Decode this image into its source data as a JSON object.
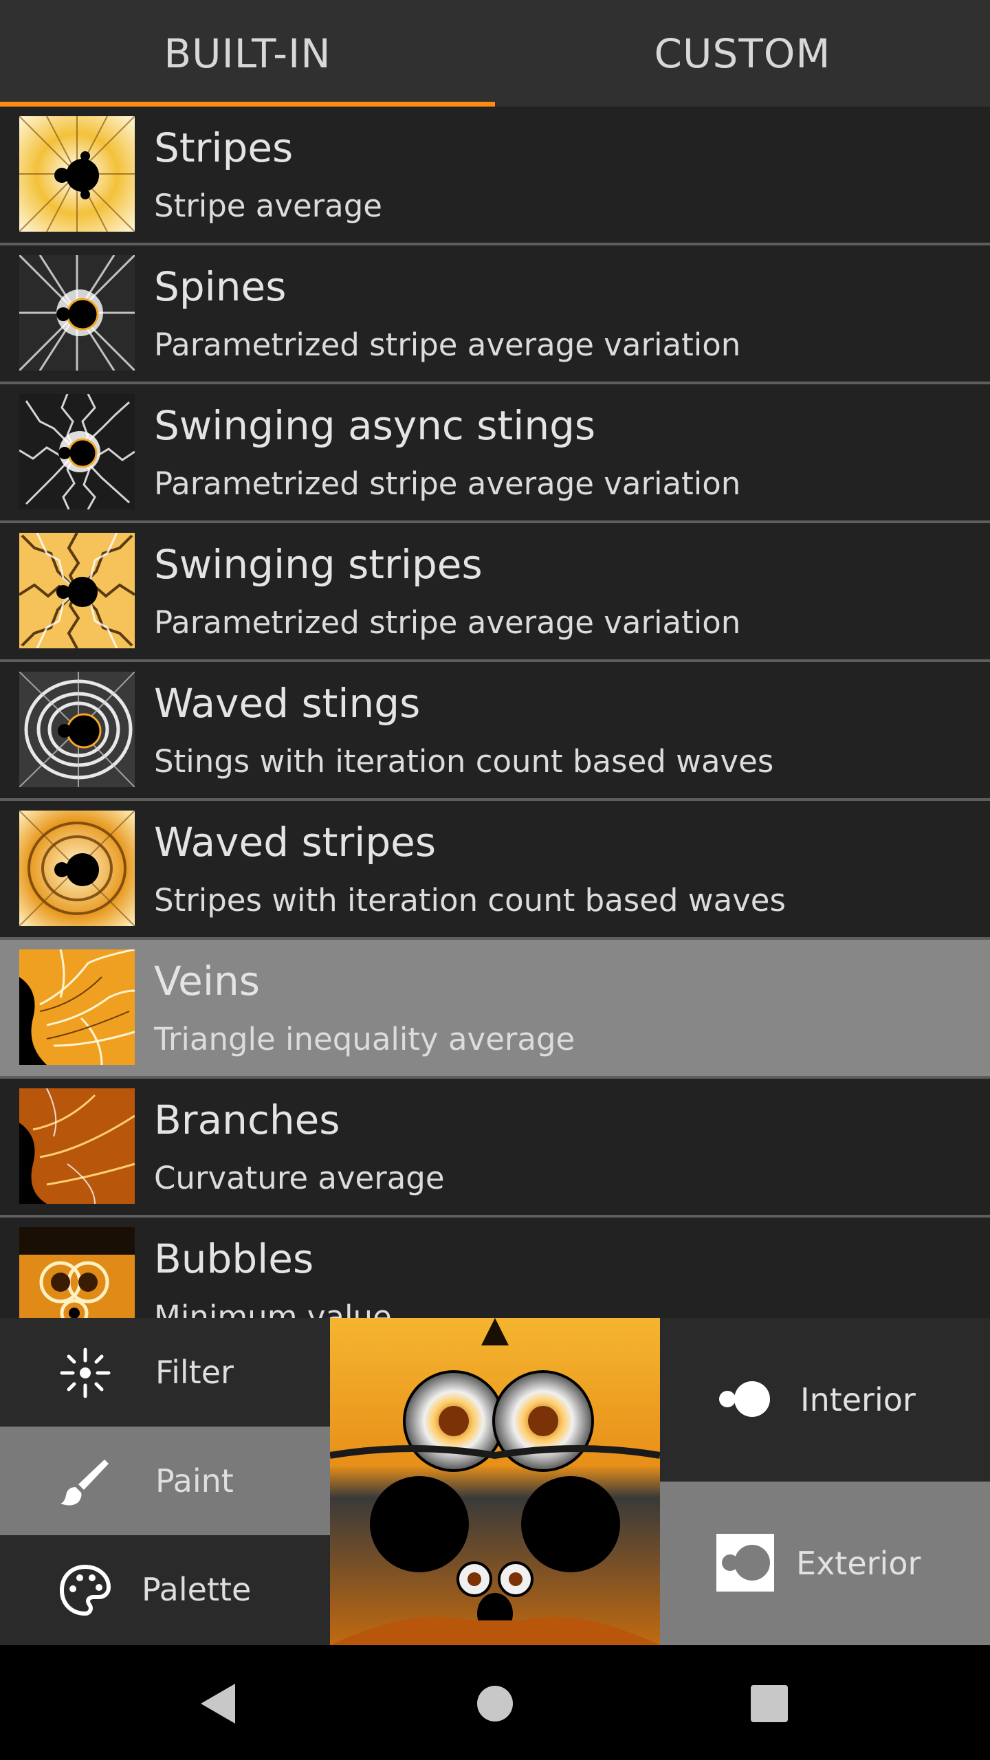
{
  "tabs": [
    {
      "label": "BUILT-IN",
      "active": true
    },
    {
      "label": "CUSTOM",
      "active": false
    }
  ],
  "accent_color": "#ff8c10",
  "list": [
    {
      "title": "Stripes",
      "subtitle": "Stripe average"
    },
    {
      "title": "Spines",
      "subtitle": "Parametrized stripe average variation"
    },
    {
      "title": "Swinging async stings",
      "subtitle": "Parametrized stripe average variation"
    },
    {
      "title": "Swinging stripes",
      "subtitle": "Parametrized stripe average variation"
    },
    {
      "title": "Waved stings",
      "subtitle": "Stings with iteration count based waves"
    },
    {
      "title": "Waved stripes",
      "subtitle": "Stripes with iteration count based waves"
    },
    {
      "title": "Veins",
      "subtitle": "Triangle inequality average",
      "selected": true
    },
    {
      "title": "Branches",
      "subtitle": "Curvature average"
    },
    {
      "title": "Bubbles",
      "subtitle": "Minimum value"
    }
  ],
  "modes": [
    {
      "label": "Filter",
      "icon": "filter-sparkle-icon"
    },
    {
      "label": "Paint",
      "icon": "brush-icon",
      "active": true
    },
    {
      "label": "Palette",
      "icon": "palette-icon"
    }
  ],
  "options": [
    {
      "label": "Interior",
      "icon": "toggle-interior-icon"
    },
    {
      "label": "Exterior",
      "icon": "toggle-exterior-icon",
      "active": true
    }
  ],
  "nav": {
    "back_icon": "back-triangle-icon",
    "home_icon": "home-circle-icon",
    "recents_icon": "recents-square-icon"
  }
}
